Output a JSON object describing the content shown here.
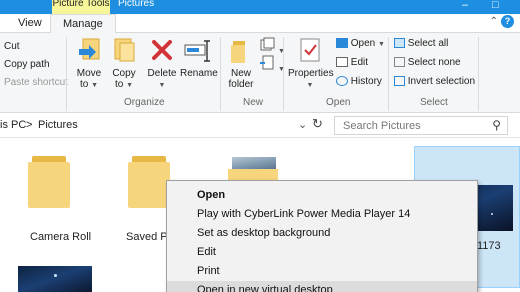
{
  "titlebar": {
    "contextual_tab": "Picture Tools",
    "title": "Pictures",
    "minimize": "–",
    "maximize": "□"
  },
  "tabs": [
    {
      "label": "View"
    },
    {
      "label": "Manage"
    }
  ],
  "ribbon": {
    "clipboard": {
      "cut": "Cut",
      "copy_path": "Copy path",
      "paste_shortcut": "Paste shortcut"
    },
    "organize": {
      "label": "Organize",
      "move_to": [
        "Move",
        "to"
      ],
      "copy_to": [
        "Copy",
        "to"
      ],
      "delete": "Delete",
      "rename": "Rename"
    },
    "new": {
      "label": "New",
      "new_folder": [
        "New",
        "folder"
      ]
    },
    "open": {
      "label": "Open",
      "properties": "Properties",
      "open": "Open",
      "edit": "Edit",
      "history": "History"
    },
    "select": {
      "label": "Select",
      "select_all": "Select all",
      "select_none": "Select none",
      "invert_selection": "Invert selection"
    }
  },
  "address": {
    "crumb_pc": "is PC",
    "sep": ">",
    "crumb_pictures": "Pictures"
  },
  "search": {
    "placeholder": "Search Pictures"
  },
  "items": [
    {
      "label": "Camera Roll"
    },
    {
      "label": "Saved Pic"
    },
    {
      "label": "1173"
    }
  ],
  "context_menu": [
    {
      "label": "Open",
      "bold": true
    },
    {
      "label": "Play with CyberLink Power Media Player 14"
    },
    {
      "label": "Set as desktop background"
    },
    {
      "label": "Edit"
    },
    {
      "label": "Print"
    },
    {
      "label": "Open in new virtual desktop"
    }
  ],
  "colors": {
    "titlebar": "#1e8fe0",
    "contextual_tab": "#f7f59a",
    "folder": "#f7d57c",
    "selection": "#cde6f7"
  }
}
